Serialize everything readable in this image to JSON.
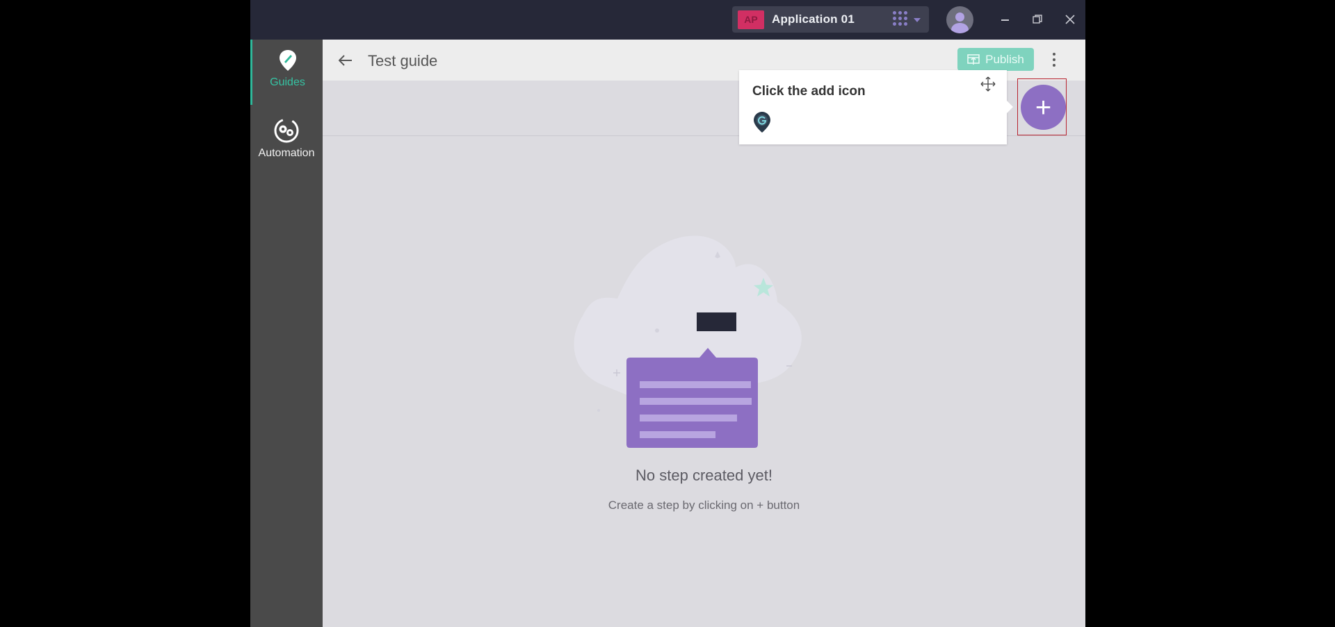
{
  "titlebar": {
    "app_badge": "AP",
    "app_name": "Application 01"
  },
  "leftnav": {
    "items": [
      {
        "label": "Guides",
        "icon": "guides-pin-icon",
        "active": true
      },
      {
        "label": "Automation",
        "icon": "automation-gears-icon",
        "active": false
      }
    ]
  },
  "header": {
    "title": "Test guide",
    "publish_label": "Publish"
  },
  "tooltip": {
    "title": "Click the add icon"
  },
  "empty_state": {
    "title": "No step created yet!",
    "subtitle": "Create a step by clicking on + button"
  },
  "add_button": {
    "label": "+"
  },
  "colors": {
    "accent_green": "#2fb89a",
    "accent_purple": "#8d6fc3",
    "badge": "#d12f63",
    "titlebar": "#262838",
    "highlight": "#b8232f"
  }
}
